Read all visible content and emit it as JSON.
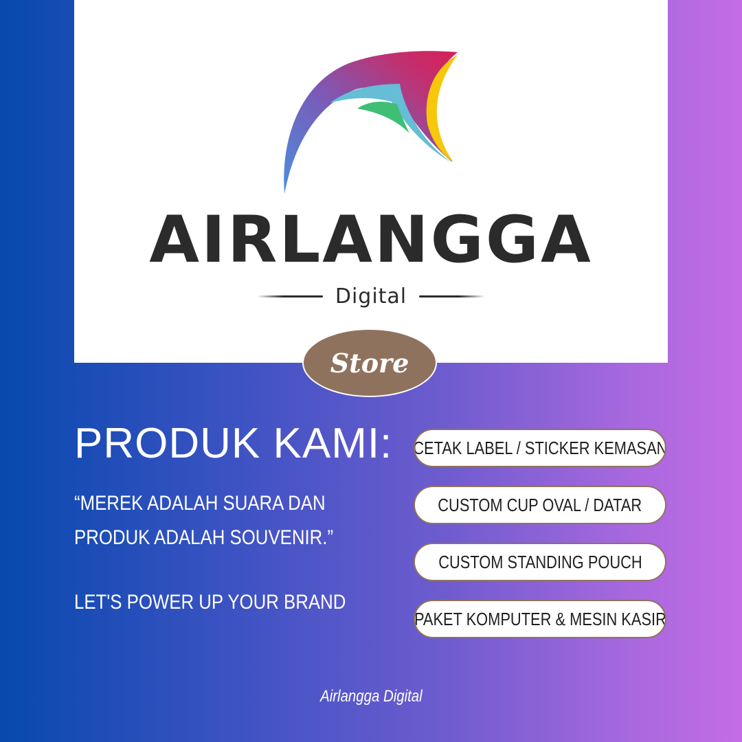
{
  "logo": {
    "brand_name": "AIRLANGGA",
    "brand_sub": "Digital",
    "icon": "airlangga-swoosh-logo-icon"
  },
  "badge": {
    "label": "Store"
  },
  "content": {
    "heading": "PRODUK KAMI:",
    "tagline": "“MEREK ADALAH SUARA DAN PRODUK ADALAH SOUVENIR.”",
    "slogan": "LET'S POWER UP YOUR BRAND"
  },
  "products": [
    {
      "label": "CETAK LABEL / STICKER KEMASAN"
    },
    {
      "label": "CUSTOM CUP OVAL / DATAR"
    },
    {
      "label": "CUSTOM STANDING POUCH"
    },
    {
      "label": "PAKET KOMPUTER & MESIN KASIR"
    }
  ],
  "footer": {
    "text": "Airlangga Digital"
  },
  "colors": {
    "gradient_start": "#0749ae",
    "gradient_end": "#c46ce6",
    "badge_brown": "#8f725e",
    "brand_text": "#2b2b2b"
  }
}
